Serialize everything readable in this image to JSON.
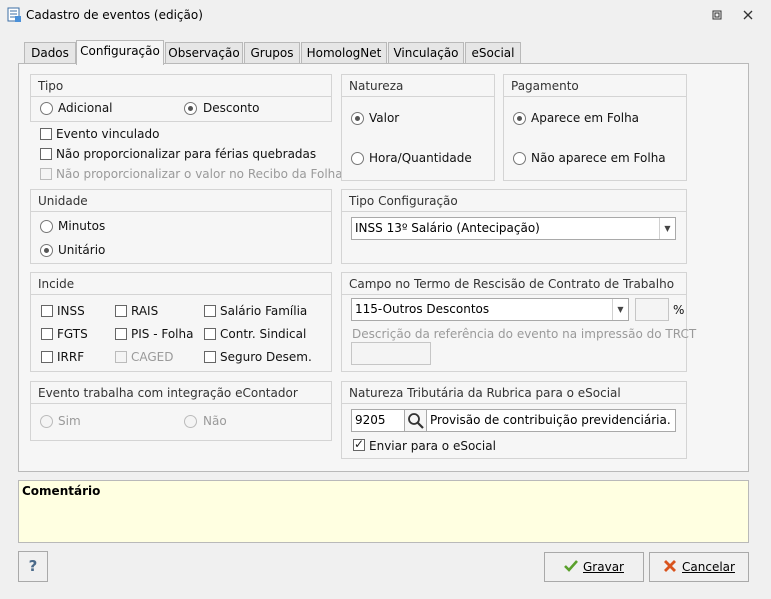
{
  "window": {
    "title": "Cadastro de eventos (edição)"
  },
  "tabs": [
    "Dados",
    "Configuração",
    "Observação",
    "Grupos",
    "HomologNet",
    "Vinculação",
    "eSocial"
  ],
  "tipo": {
    "title": "Tipo",
    "opt_adicional": "Adicional",
    "opt_desconto": "Desconto",
    "selected": "Desconto"
  },
  "checks": {
    "evento_vinculado": "Evento vinculado",
    "nao_prop_ferias": "Não proporcionalizar para férias quebradas",
    "nao_prop_recibo": "Não proporcionalizar o valor no Recibo da Folha"
  },
  "natureza": {
    "title": "Natureza",
    "opt_valor": "Valor",
    "opt_hora": "Hora/Quantidade",
    "selected": "Valor"
  },
  "pagamento": {
    "title": "Pagamento",
    "opt_aparece": "Aparece em Folha",
    "opt_nao_aparece": "Não aparece em Folha",
    "selected": "Aparece em Folha"
  },
  "unidade": {
    "title": "Unidade",
    "opt_minutos": "Minutos",
    "opt_unitario": "Unitário",
    "selected": "Unitário"
  },
  "tipo_config": {
    "title": "Tipo Configuração",
    "value": "INSS 13º Salário (Antecipação)"
  },
  "incide": {
    "title": "Incide",
    "inss": "INSS",
    "rais": "RAIS",
    "salario_familia": "Salário Família",
    "fgts": "FGTS",
    "pis_folha": "PIS - Folha",
    "contr_sindical": "Contr. Sindical",
    "irrf": "IRRF",
    "caged": "CAGED",
    "seguro_desem": "Seguro Desem."
  },
  "rescisao": {
    "title": "Campo no Termo de Rescisão de Contrato de Trabalho",
    "value": "115-Outros Descontos",
    "percent_symbol": "%",
    "desc_label": "Descrição da referência do evento na impressão do TRCT"
  },
  "econtador": {
    "title": "Evento trabalha com integração eContador",
    "opt_sim": "Sim",
    "opt_nao": "Não"
  },
  "esocial": {
    "title": "Natureza Tributária da Rubrica para o eSocial",
    "code": "9205",
    "description": "Provisão de contribuição previdenciária.",
    "enviar_label": "Enviar para o eSocial"
  },
  "comment": {
    "label": "Comentário"
  },
  "buttons": {
    "help": "?",
    "gravar": "Gravar",
    "cancelar": "Cancelar"
  },
  "colors": {
    "comment_bg": "#ffffe1",
    "gravar_icon": "#5aa02c",
    "cancelar_icon": "#d9541e"
  }
}
